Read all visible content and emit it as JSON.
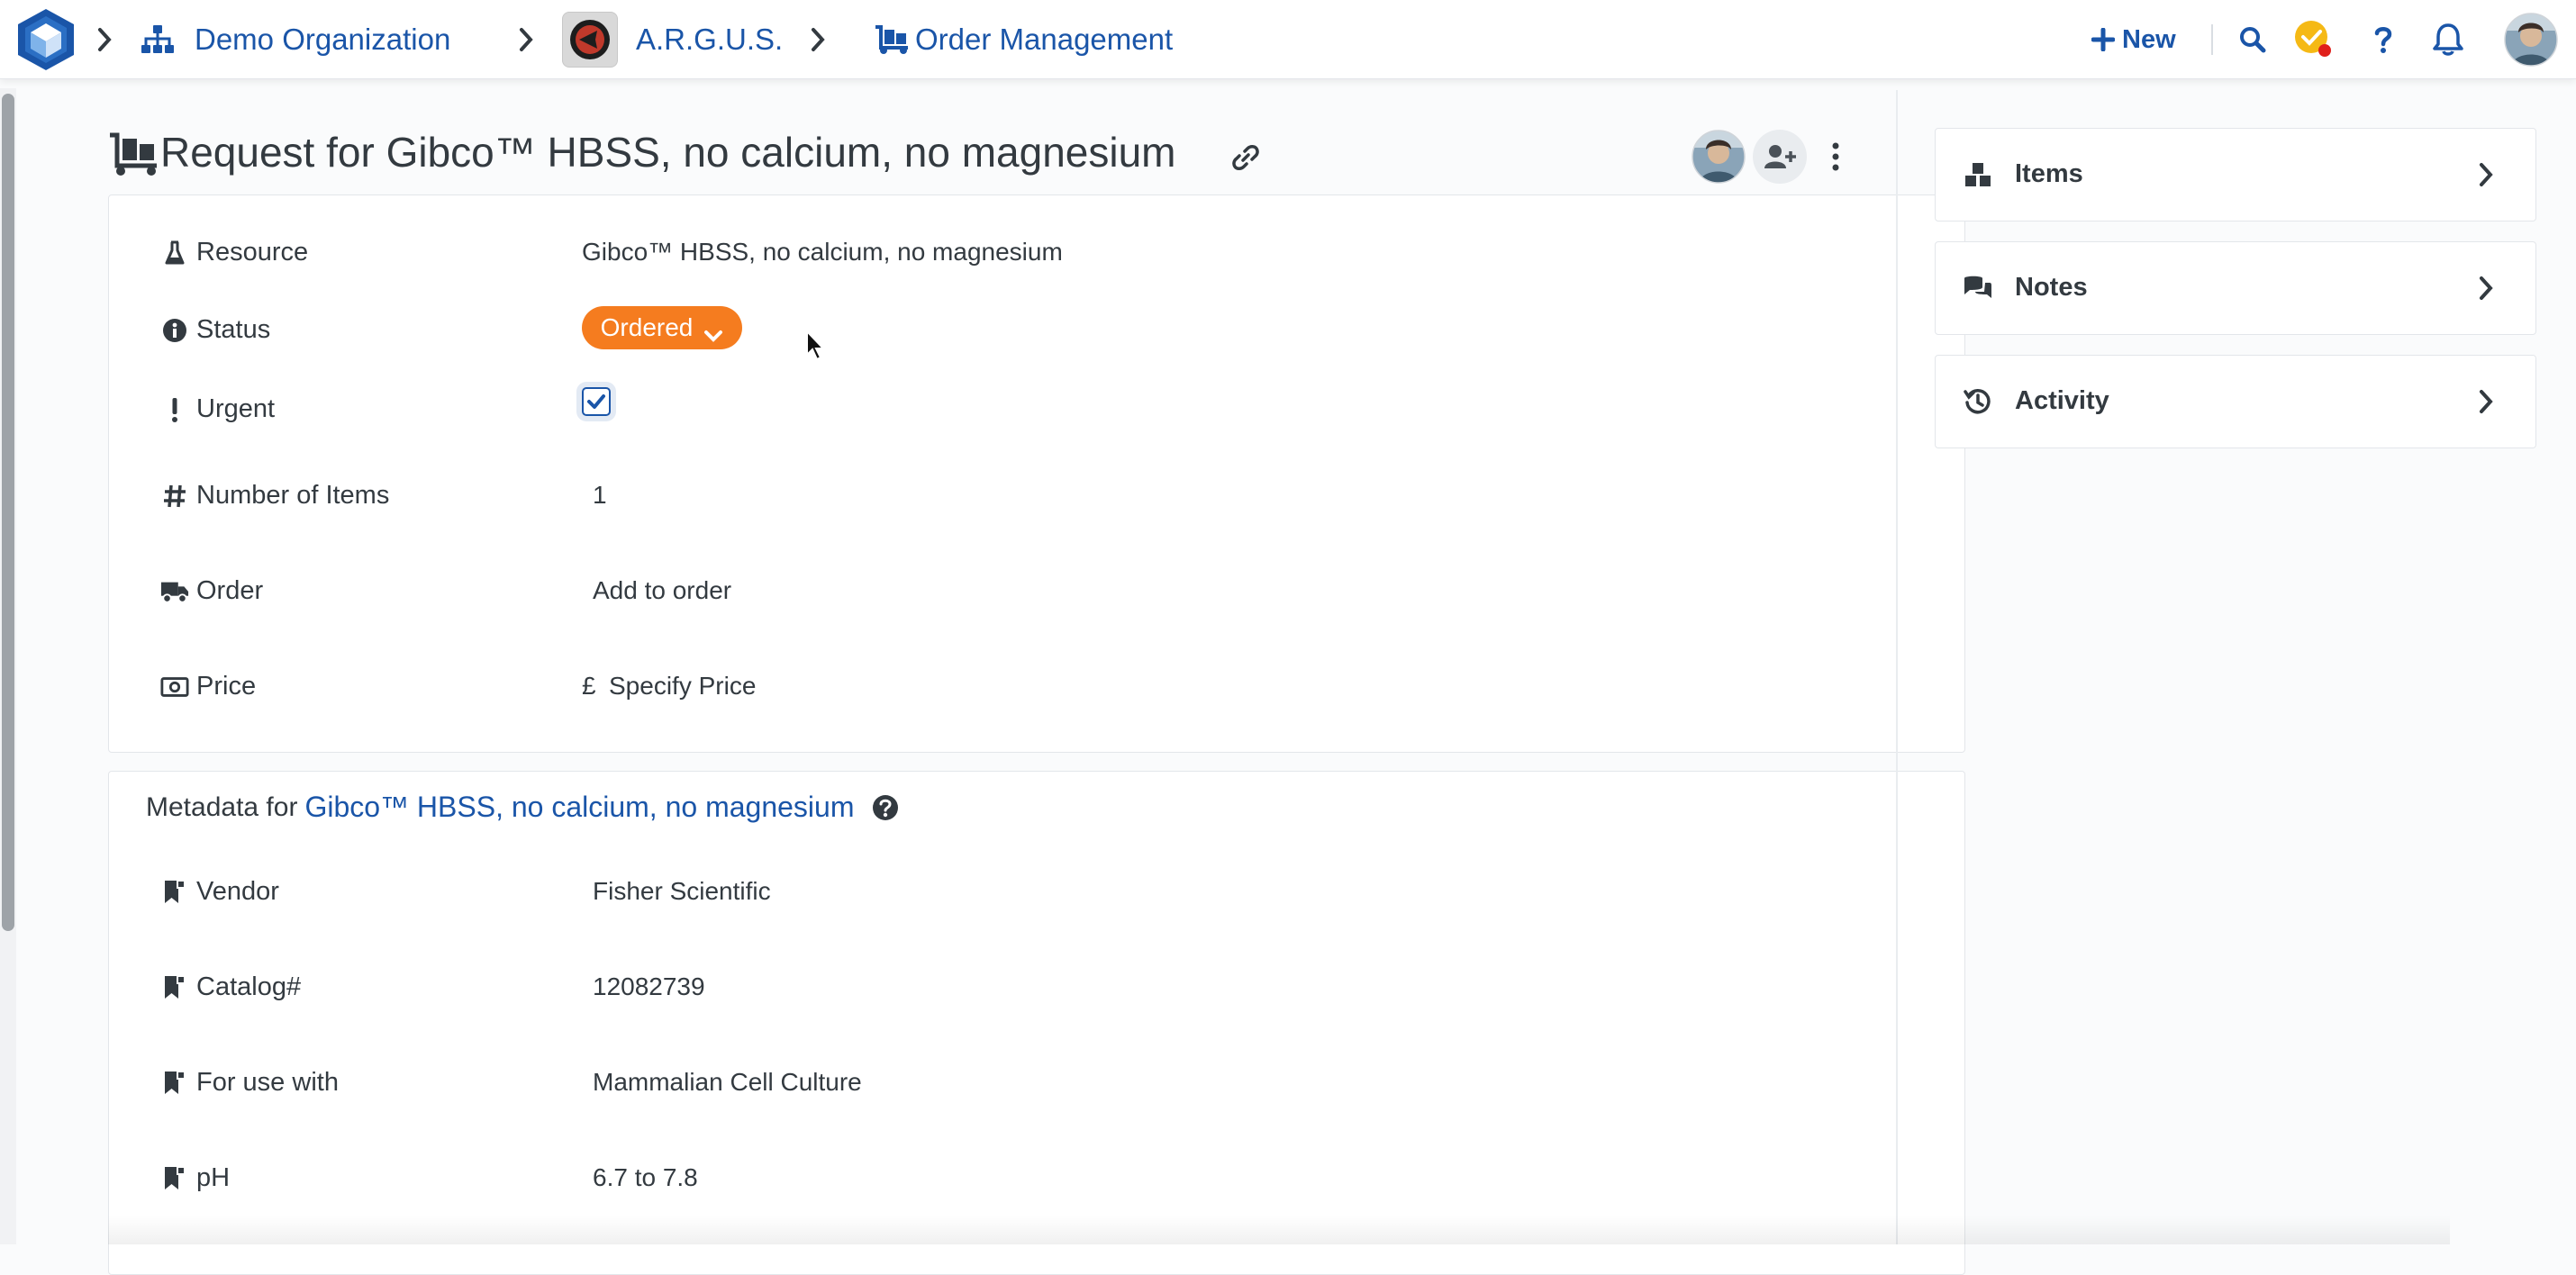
{
  "breadcrumb": {
    "organization": "Demo Organization",
    "project": "A.R.G.U.S.",
    "module": "Order Management"
  },
  "toolbar": {
    "new_label": "New"
  },
  "icons": {
    "logo": "cube-logo-icon",
    "organization": "sitemap-icon",
    "module": "dolly-cart-icon",
    "search": "search-icon",
    "tasks": "check-badge-icon",
    "help": "question-icon",
    "notifications": "bell-icon"
  },
  "colors": {
    "accent": "#1a55a8",
    "status_ordered": "#f57c1f",
    "notification_dot": "#e0201b",
    "tasks_badge": "#f5b915"
  },
  "request": {
    "title": "Request for Gibco™ HBSS, no calcium, no magnesium",
    "fields": {
      "resource_label": "Resource",
      "resource_value": "Gibco™ HBSS, no calcium, no magnesium",
      "status_label": "Status",
      "status_value": "Ordered",
      "urgent_label": "Urgent",
      "urgent_checked": true,
      "items_label": "Number of Items",
      "items_value": "1",
      "order_label": "Order",
      "order_placeholder": "Add to order",
      "price_label": "Price",
      "price_currency": "£",
      "price_placeholder": "Specify Price"
    }
  },
  "metadata": {
    "heading_prefix": "Metadata for",
    "heading_link": "Gibco™ HBSS, no calcium, no magnesium",
    "rows": [
      {
        "label": "Vendor",
        "value": "Fisher Scientific"
      },
      {
        "label": "Catalog#",
        "value": "12082739"
      },
      {
        "label": "For use with",
        "value": "Mammalian Cell Culture"
      },
      {
        "label": "pH",
        "value": "6.7 to 7.8"
      }
    ]
  },
  "side_panel": {
    "items": [
      {
        "label": "Items",
        "icon": "cubes-icon"
      },
      {
        "label": "Notes",
        "icon": "comments-icon"
      },
      {
        "label": "Activity",
        "icon": "history-icon"
      }
    ]
  }
}
